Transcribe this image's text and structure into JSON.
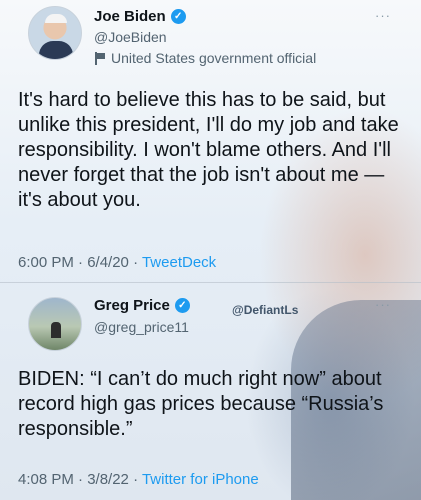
{
  "tweet1": {
    "name": "Joe Biden",
    "handle": "@JoeBiden",
    "label": "United States government official",
    "more": "···",
    "text": "It's hard to believe this has to be said, but unlike this president, I'll do my job and take responsibility. I won't blame others. And I'll never forget that the job isn't about me — it's about you.",
    "time": "6:00 PM · 6/4/20 · ",
    "source": "TweetDeck"
  },
  "tweet2": {
    "name": "Greg Price",
    "handle": "@greg_price11",
    "watermark": "@DefiantLs",
    "more": "···",
    "text": "BIDEN: “I can’t do much right now” about record high gas prices because “Russia’s responsible.”",
    "time": "4:08 PM · 3/8/22 · ",
    "source": "Twitter for iPhone"
  },
  "icons": {
    "verified": "verified-badge-icon",
    "label": "flag-icon"
  },
  "colors": {
    "verified": "#1d9bf0",
    "link": "#1d9bf0",
    "secondary_text": "#536471"
  }
}
